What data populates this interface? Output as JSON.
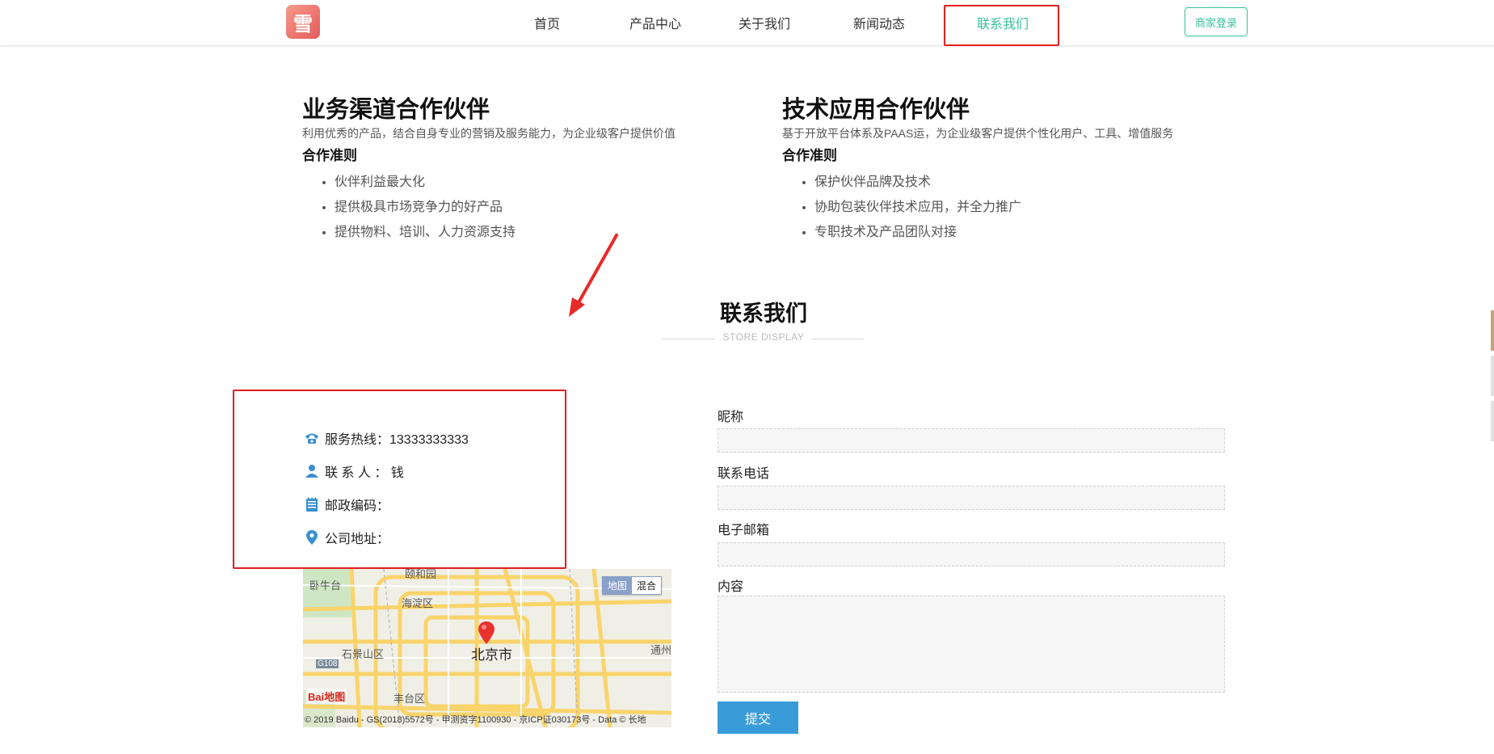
{
  "nav": {
    "logo_glyph": "雪",
    "items": [
      {
        "label": "首页"
      },
      {
        "label": "产品中心"
      },
      {
        "label": "关于我们"
      },
      {
        "label": "新闻动态"
      },
      {
        "label": "联系我们",
        "active": true
      }
    ],
    "login_label": "商家登录"
  },
  "partners": [
    {
      "title": "业务渠道合作伙伴",
      "desc": "利用优秀的产品，结合自身专业的营销及服务能力，为企业级客户提供价值",
      "rule_title": "合作准则",
      "rules": [
        "伙伴利益最大化",
        "提供极具市场竞争力的好产品",
        "提供物料、培训、人力资源支持"
      ]
    },
    {
      "title": "技术应用合作伙伴",
      "desc": "基于开放平台体系及PAAS运，为企业级客户提供个性化用户、工具、增值服务",
      "rule_title": "合作准则",
      "rules": [
        "保护伙伴品牌及技术",
        "协助包装伙伴技术应用，并全力推广",
        "专职技术及产品团队对接"
      ]
    }
  ],
  "contact_section": {
    "title": "联系我们",
    "subtitle": "STORE DISPLAY"
  },
  "contact_info": {
    "hotline": "服务热线：13333333333",
    "person": "联 系 人 ： 钱",
    "postcode": "邮政编码：",
    "address": "公司地址："
  },
  "map": {
    "toggle_map": "地图",
    "toggle_hybrid": "混合",
    "city": "北京市",
    "labels": [
      "卧牛台",
      "颐和园",
      "海淀区",
      "石景山区",
      "丰台区",
      "通州",
      "G108"
    ],
    "copyright": "© 2019 Baidu - GS(2018)5572号 - 甲测资字1100930 - 京ICP证030173号 - Data © 长地",
    "brand": "Bai地图"
  },
  "form": {
    "nickname_label": "昵称",
    "phone_label": "联系电话",
    "email_label": "电子邮箱",
    "content_label": "内容",
    "nickname_value": "",
    "phone_value": "",
    "email_value": "",
    "content_value": "",
    "submit_label": "提交"
  },
  "colors": {
    "accent": "#35c19b",
    "highlight_border": "#e02020",
    "submit": "#3a9bd9",
    "arrow": "#e82a2a"
  }
}
